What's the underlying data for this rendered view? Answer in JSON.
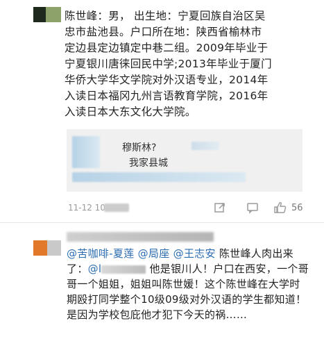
{
  "post": {
    "lines": [
      "陈世峰：男， 出生地：宁夏回族自治区吴",
      "忠市盐池县。户口所在地：陕西省榆林市",
      "定边县定边镇定中巷二组。2009年毕业于",
      "宁夏银川唐徕回民中学;2013年毕业于厦门",
      "华侨大学华文学院对外汉语专业，2014年",
      "入读日本福冈九州言语教育学院，2016年",
      "入读日本大东文化大学院。"
    ]
  },
  "quote": {
    "line1": "穆斯林?",
    "line2": "我家县城"
  },
  "meta": {
    "time": "11-12 10",
    "like_count": "56",
    "share_icon": "share-icon",
    "comment_icon": "comment-icon",
    "like_icon": "thumbs-up-icon"
  },
  "comment": {
    "mention1": "@苦咖啡-夏莲",
    "mention2": "@局座",
    "mention3": "@王志安",
    "text1": "陈世峰人肉出来了",
    "mention4": "@l",
    "text2": "他是银川人！户口在西安，一个哥哥一个姐姐，姐姐叫陈世媛！这个陈世峰在大学时期殴打同学整个10级09级对外汉语的学生都知道！是因为学校包庇他才犯下今天的祸",
    "text3": "……"
  },
  "colors": {
    "mention": "#2b6cb0",
    "meta": "#999999"
  }
}
